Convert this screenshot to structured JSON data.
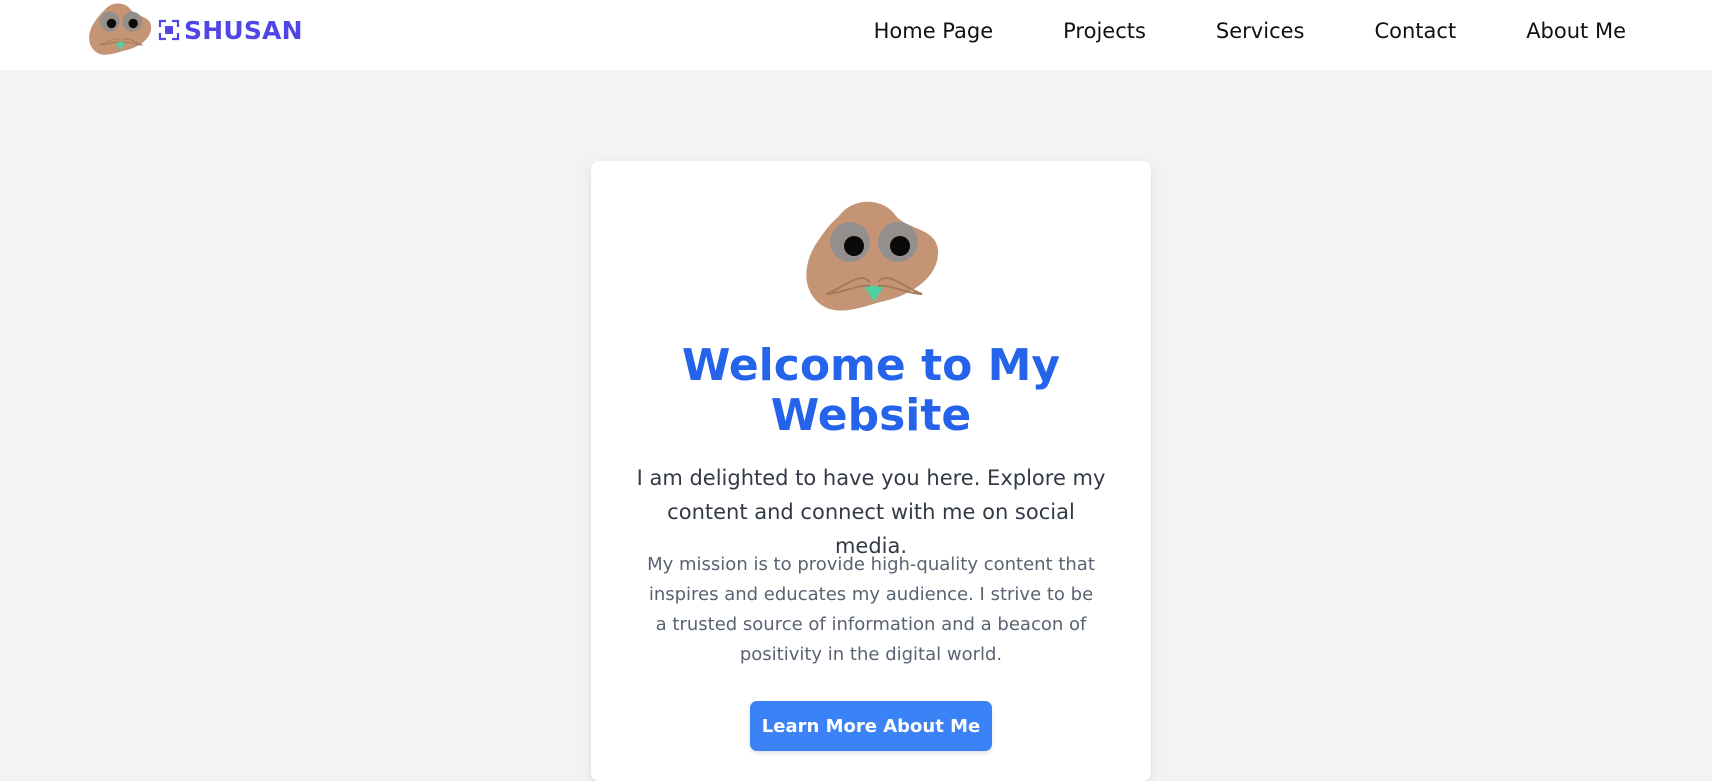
{
  "header": {
    "brand_name": "SHUSAN",
    "brand_logo": "cartoon-face-logo",
    "brand_icon": "scan-focus-icon",
    "nav": [
      {
        "label": "Home Page"
      },
      {
        "label": "Projects"
      },
      {
        "label": "Services"
      },
      {
        "label": "Contact"
      },
      {
        "label": "About Me"
      }
    ]
  },
  "hero": {
    "avatar": "cartoon-face-avatar",
    "title": "Welcome to My Website",
    "intro": "I am delighted to have you here. Explore my content and connect with me on social media.",
    "mission": "My mission is to provide high-quality content that inspires and educates my audience. I strive to be a trusted source of information and a beacon of positivity in the digital world.",
    "cta_label": "Learn More About Me"
  },
  "colors": {
    "brand": "#4f46e5",
    "title": "#2563eb",
    "button": "#3b82f6",
    "page_background": "#f2f3f5",
    "face": "#c49474"
  }
}
